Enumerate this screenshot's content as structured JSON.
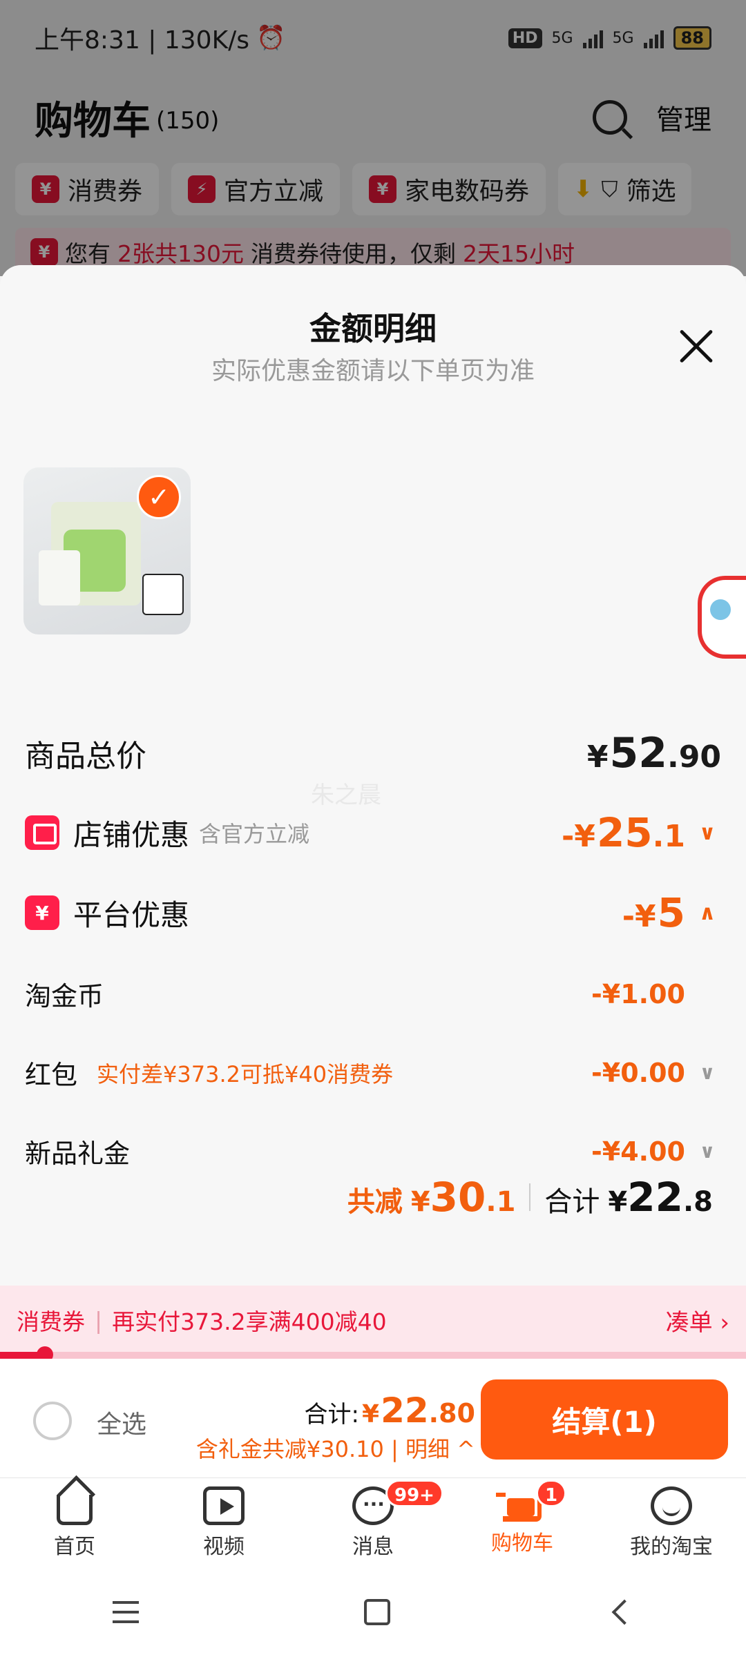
{
  "status_bar": {
    "time_speed": "上午8:31 | 130K/s",
    "alarm_icon": "alarm-icon",
    "hd": "HD",
    "signal1": "5G",
    "signal2": "5G",
    "battery": "88"
  },
  "header": {
    "title": "购物车",
    "count": "(150)",
    "manage": "管理"
  },
  "chips": [
    {
      "label": "消费券",
      "icon": "¥"
    },
    {
      "label": "官方立减",
      "icon": "⚡"
    },
    {
      "label": "家电数码券",
      "icon": "¥"
    },
    {
      "label": "筛选"
    }
  ],
  "coupon_notice": {
    "prefix": "您有",
    "highlight1": "2张共130元",
    "middle": "消费券待使用，仅剩",
    "highlight2": "2天15小时"
  },
  "sheet": {
    "title": "金额明细",
    "subtitle": "实际优惠金额请以下单页为准",
    "watermark": "朱之晨"
  },
  "breakdown": {
    "total": {
      "label": "商品总价",
      "currency": "¥",
      "integer": "52",
      "cents": ".90"
    },
    "store": {
      "label": "店铺优惠",
      "note": "含官方立减",
      "prefix": "-¥",
      "integer": "25",
      "cents": ".1"
    },
    "platform": {
      "label": "平台优惠",
      "icon": "¥",
      "prefix": "-¥",
      "integer": "5"
    },
    "coins": {
      "label": "淘金币",
      "amount": "-¥1.00"
    },
    "red_packet": {
      "label": "红包",
      "note": "实付差¥373.2可抵¥40消费券",
      "amount": "-¥0.00"
    },
    "gift": {
      "label": "新品礼金",
      "amount": "-¥4.00"
    },
    "saved_label": "共减",
    "saved_currency": "¥",
    "saved_integer": "30",
    "saved_cents": ".1",
    "sum_label": "合计",
    "sum_currency": "¥",
    "sum_integer": "22",
    "sum_cents": ".8"
  },
  "coupon_bar": {
    "tag": "消费券",
    "desc": "再实付373.2享满400减40",
    "link": "凑单 ›",
    "progress": 0.06
  },
  "checkout": {
    "select_all": "全选",
    "total_label": "合计:",
    "currency": "¥",
    "integer": "22",
    "cents": ".80",
    "detail": "含礼金共减¥30.10 | 明细 ^",
    "button": "结算(1)"
  },
  "tabs": [
    {
      "label": "首页",
      "icon": "home-icon"
    },
    {
      "label": "视频",
      "icon": "video-icon"
    },
    {
      "label": "消息",
      "icon": "message-icon",
      "badge": "99+"
    },
    {
      "label": "购物车",
      "icon": "cart-icon",
      "badge": "1",
      "active": true
    },
    {
      "label": "我的淘宝",
      "icon": "profile-icon"
    }
  ]
}
